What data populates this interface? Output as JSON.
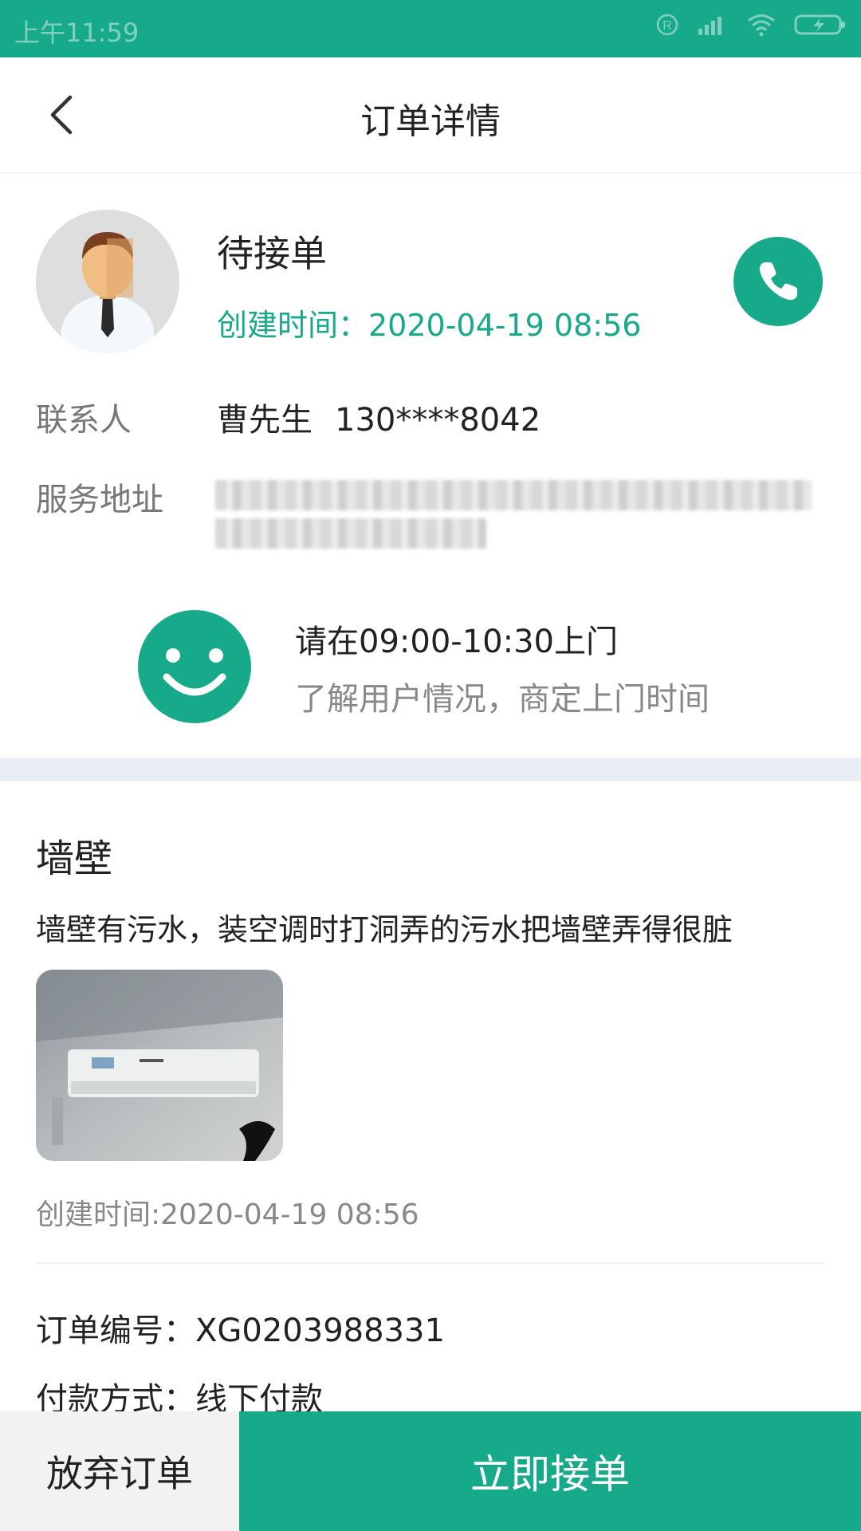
{
  "status_bar": {
    "time": "上午11:59"
  },
  "header": {
    "title": "订单详情"
  },
  "order": {
    "status": "待接单",
    "created_time": "创建时间：2020-04-19 08:56",
    "contact_label": "联系人",
    "contact_name": "曹先生",
    "contact_phone": "130****8042",
    "address_label": "服务地址"
  },
  "visit": {
    "title": "请在09:00-10:30上门",
    "subtitle": "了解用户情况，商定上门时间"
  },
  "item": {
    "category": "墙壁",
    "description": "墙壁有污水，装空调时打洞弄的污水把墙壁弄得很脏",
    "created_time": "创建时间:2020-04-19 08:56",
    "order_number": "订单编号：XG0203988331",
    "payment_method": "付款方式：线下付款"
  },
  "actions": {
    "abandon_label": "放弃订单",
    "accept_label": "立即接单"
  },
  "colors": {
    "accent": "#17aa8a",
    "divider": "#e9edf4"
  },
  "icons": [
    "back-icon",
    "phone-icon",
    "smile-icon",
    "avatar-icon",
    "wifi-icon",
    "signal-icon",
    "battery-icon"
  ]
}
